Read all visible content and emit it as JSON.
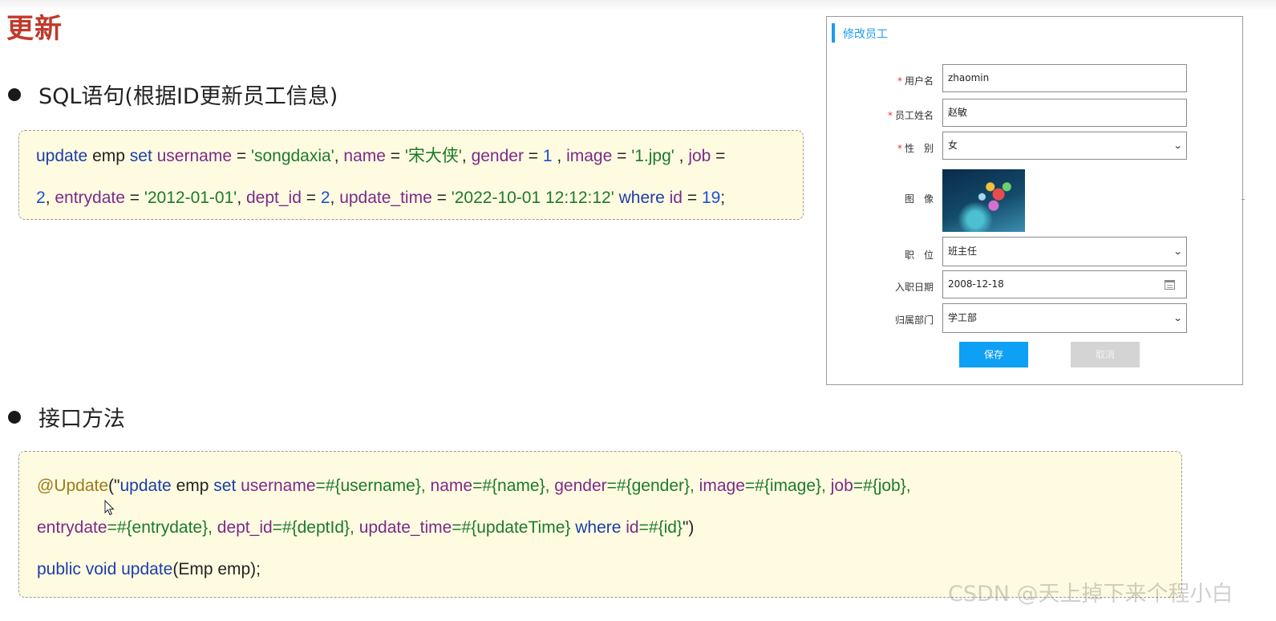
{
  "page_title": "更新",
  "sections": {
    "sql": {
      "bullet": "SQL语句(根据ID更新员工信息)"
    },
    "interface": {
      "bullet": "接口方法"
    }
  },
  "sql_code": {
    "line1": [
      {
        "t": "update",
        "c": "kw"
      },
      {
        "t": " emp ",
        "c": "plain"
      },
      {
        "t": "set",
        "c": "kw"
      },
      {
        "t": " ",
        "c": "plain"
      },
      {
        "t": "username",
        "c": "col"
      },
      {
        "t": " = ",
        "c": "plain"
      },
      {
        "t": "'songdaxia'",
        "c": "str"
      },
      {
        "t": ", ",
        "c": "plain"
      },
      {
        "t": "name",
        "c": "col"
      },
      {
        "t": " = ",
        "c": "plain"
      },
      {
        "t": "'宋大侠'",
        "c": "str"
      },
      {
        "t": ", ",
        "c": "plain"
      },
      {
        "t": "gender",
        "c": "col"
      },
      {
        "t": " = ",
        "c": "plain"
      },
      {
        "t": "1",
        "c": "num"
      },
      {
        "t": " , ",
        "c": "plain"
      },
      {
        "t": "image",
        "c": "col"
      },
      {
        "t": " = ",
        "c": "plain"
      },
      {
        "t": "'1.jpg'",
        "c": "str"
      },
      {
        "t": " , ",
        "c": "plain"
      },
      {
        "t": "job",
        "c": "col"
      },
      {
        "t": " =",
        "c": "plain"
      }
    ],
    "line2": [
      {
        "t": "2",
        "c": "num"
      },
      {
        "t": ", ",
        "c": "plain"
      },
      {
        "t": "entrydate",
        "c": "col"
      },
      {
        "t": " = ",
        "c": "plain"
      },
      {
        "t": "'2012-01-01'",
        "c": "str"
      },
      {
        "t": ", ",
        "c": "plain"
      },
      {
        "t": "dept_id",
        "c": "col"
      },
      {
        "t": " = ",
        "c": "plain"
      },
      {
        "t": "2",
        "c": "num"
      },
      {
        "t": ", ",
        "c": "plain"
      },
      {
        "t": "update_time",
        "c": "col"
      },
      {
        "t": " = ",
        "c": "plain"
      },
      {
        "t": "'2022-10-01 12:12:12'",
        "c": "str"
      },
      {
        "t": " ",
        "c": "plain"
      },
      {
        "t": "where",
        "c": "kw"
      },
      {
        "t": " ",
        "c": "plain"
      },
      {
        "t": "id",
        "c": "col"
      },
      {
        "t": " = ",
        "c": "plain"
      },
      {
        "t": "19",
        "c": "num"
      },
      {
        "t": ";",
        "c": "plain"
      }
    ]
  },
  "java_code": {
    "line1": [
      {
        "t": "@Update",
        "c": "anno"
      },
      {
        "t": "(\"",
        "c": "plain"
      },
      {
        "t": "update",
        "c": "kw"
      },
      {
        "t": " emp ",
        "c": "plain"
      },
      {
        "t": "set",
        "c": "kw"
      },
      {
        "t": " ",
        "c": "plain"
      },
      {
        "t": "username",
        "c": "col"
      },
      {
        "t": "=#{username}, ",
        "c": "str"
      },
      {
        "t": "name",
        "c": "col"
      },
      {
        "t": "=#{name}, ",
        "c": "str"
      },
      {
        "t": "gender",
        "c": "col"
      },
      {
        "t": "=#{gender}, ",
        "c": "str"
      },
      {
        "t": "image",
        "c": "col"
      },
      {
        "t": "=#{image}, ",
        "c": "str"
      },
      {
        "t": "job",
        "c": "col"
      },
      {
        "t": "=#{job},",
        "c": "str"
      }
    ],
    "line2": [
      {
        "t": "entrydate",
        "c": "col"
      },
      {
        "t": "=#{entrydate}, ",
        "c": "str"
      },
      {
        "t": "dept_id",
        "c": "col"
      },
      {
        "t": "=#{deptId}, ",
        "c": "str"
      },
      {
        "t": "update_time",
        "c": "col"
      },
      {
        "t": "=#{updateTime} ",
        "c": "str"
      },
      {
        "t": "where",
        "c": "kw"
      },
      {
        "t": " ",
        "c": "plain"
      },
      {
        "t": "id",
        "c": "col"
      },
      {
        "t": "=#{id}",
        "c": "str"
      },
      {
        "t": "\")",
        "c": "plain"
      }
    ],
    "line3": [
      {
        "t": "public",
        "c": "kw"
      },
      {
        "t": " ",
        "c": "plain"
      },
      {
        "t": "void",
        "c": "kw"
      },
      {
        "t": " ",
        "c": "plain"
      },
      {
        "t": "update",
        "c": "fn"
      },
      {
        "t": "(Emp emp);",
        "c": "plain"
      }
    ]
  },
  "form": {
    "title": "修改员工",
    "username": {
      "label": "用户名",
      "value": "zhaomin"
    },
    "name": {
      "label": "员工姓名",
      "value": "赵敏"
    },
    "gender": {
      "label": "性　别",
      "value": "女"
    },
    "image": {
      "label": "图　像"
    },
    "job": {
      "label": "职　位",
      "value": "班主任"
    },
    "entrydate": {
      "label": "入职日期",
      "value": "2008-12-18"
    },
    "dept": {
      "label": "归属部门",
      "value": "学工部"
    },
    "required_mark": "*",
    "save_label": "保存",
    "cancel_label": "取消"
  },
  "icons": {
    "select_arrow": "chevron-down-icon",
    "date_picker": "calendar-icon",
    "cursor": "mouse-pointer-icon"
  },
  "colors": {
    "title_red": "#c0392b",
    "code_bg": "#fffbe1",
    "keyword": "#1b3ea8",
    "column": "#7b2a8a",
    "string": "#1b7a2b",
    "number": "#1b4fd8",
    "annotation": "#9a7b15",
    "primary_button": "#0da0f5"
  },
  "watermark": "CSDN @天上掉下来个程小白"
}
